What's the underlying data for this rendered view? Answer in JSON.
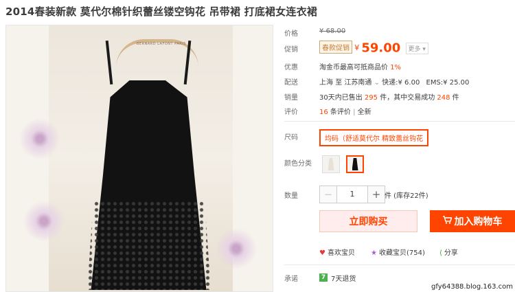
{
  "product": {
    "title": "2014春装新款 莫代尔棉针织蕾丝镂空钩花 吊带裙 打底裙女连衣裙"
  },
  "image": {
    "hanger_brand": "BERNARD LAFONT PARIS"
  },
  "price": {
    "label": "价格",
    "currency": "¥",
    "original": "68.00"
  },
  "promo": {
    "label": "促销",
    "tag": "春款促销",
    "currency": "¥",
    "price": "59.00",
    "more": "更多"
  },
  "benefit": {
    "label": "优惠",
    "text": "淘金币最高可抵商品价",
    "percent": "1%"
  },
  "shipping": {
    "label": "配送",
    "from": "上海",
    "to_word": "至",
    "to": "江苏南通",
    "express": "快递:¥ 6.00",
    "ems": "EMS:¥ 25.00"
  },
  "sales": {
    "label": "销量",
    "prefix": "30天内已售出",
    "sold": "295",
    "mid": "件，其中交易成功",
    "success": "248",
    "suffix": "件"
  },
  "reviews": {
    "label": "评价",
    "count": "16",
    "text": "条评价",
    "sep": "|",
    "new": "全新"
  },
  "size": {
    "label": "尺码",
    "option": "均码（舒适莫代尔 精致蕾丝钩花"
  },
  "color": {
    "label": "颜色分类",
    "options": [
      "white",
      "black"
    ],
    "selected": "black"
  },
  "quantity": {
    "label": "数量",
    "minus": "−",
    "value": "1",
    "plus": "+",
    "unit": "件 (库存22件)"
  },
  "actions": {
    "buy_now": "立即购买",
    "add_cart": "加入购物车"
  },
  "social": {
    "like": "喜欢宝贝",
    "fav": "收藏宝贝(754)",
    "share": "分享"
  },
  "promise": {
    "label": "承诺",
    "badge": "7",
    "text": "7天退货"
  },
  "watermark": "gfy64388.blog.163.com",
  "colors": {
    "accent": "#ff4400",
    "buy_bg": "#ffeded",
    "cart_bg": "#ff4400"
  }
}
